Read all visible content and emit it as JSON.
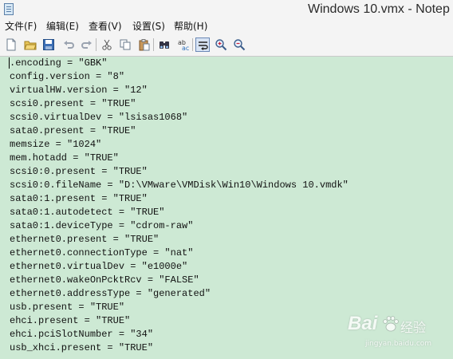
{
  "window": {
    "title": "Windows 10.vmx - Notep"
  },
  "menu": [
    {
      "label": "文件(F)"
    },
    {
      "label": "编辑(E)"
    },
    {
      "label": "查看(V)"
    },
    {
      "label": "设置(S)"
    },
    {
      "label": "帮助(H)"
    }
  ],
  "toolbar": {
    "buttons": [
      {
        "name": "new-file-icon"
      },
      {
        "name": "open-folder-icon"
      },
      {
        "name": "save-icon"
      },
      {
        "name": "undo-icon"
      },
      {
        "name": "redo-icon"
      },
      {
        "name": "cut-icon"
      },
      {
        "name": "copy-icon"
      },
      {
        "name": "paste-icon"
      },
      {
        "name": "find-icon"
      },
      {
        "name": "replace-icon"
      },
      {
        "name": "word-wrap-icon",
        "pressed": true
      },
      {
        "name": "zoom-in-icon"
      },
      {
        "name": "zoom-out-icon"
      }
    ]
  },
  "editor": {
    "lines": [
      ".encoding = \"GBK\"",
      "config.version = \"8\"",
      "virtualHW.version = \"12\"",
      "scsi0.present = \"TRUE\"",
      "scsi0.virtualDev = \"lsisas1068\"",
      "sata0.present = \"TRUE\"",
      "memsize = \"1024\"",
      "mem.hotadd = \"TRUE\"",
      "scsi0:0.present = \"TRUE\"",
      "scsi0:0.fileName = \"D:\\VMware\\VMDisk\\Win10\\Windows 10.vmdk\"",
      "sata0:1.present = \"TRUE\"",
      "sata0:1.autodetect = \"TRUE\"",
      "sata0:1.deviceType = \"cdrom-raw\"",
      "ethernet0.present = \"TRUE\"",
      "ethernet0.connectionType = \"nat\"",
      "ethernet0.virtualDev = \"e1000e\"",
      "ethernet0.wakeOnPcktRcv = \"FALSE\"",
      "ethernet0.addressType = \"generated\"",
      "usb.present = \"TRUE\"",
      "ehci.present = \"TRUE\"",
      "ehci.pciSlotNumber = \"34\"",
      "usb_xhci.present = \"TRUE\""
    ],
    "background_color": "#cde9d4"
  },
  "watermark": {
    "logo_text": "Bai",
    "experience_text": "经验",
    "url_text": "jingyan.baidu.com"
  }
}
